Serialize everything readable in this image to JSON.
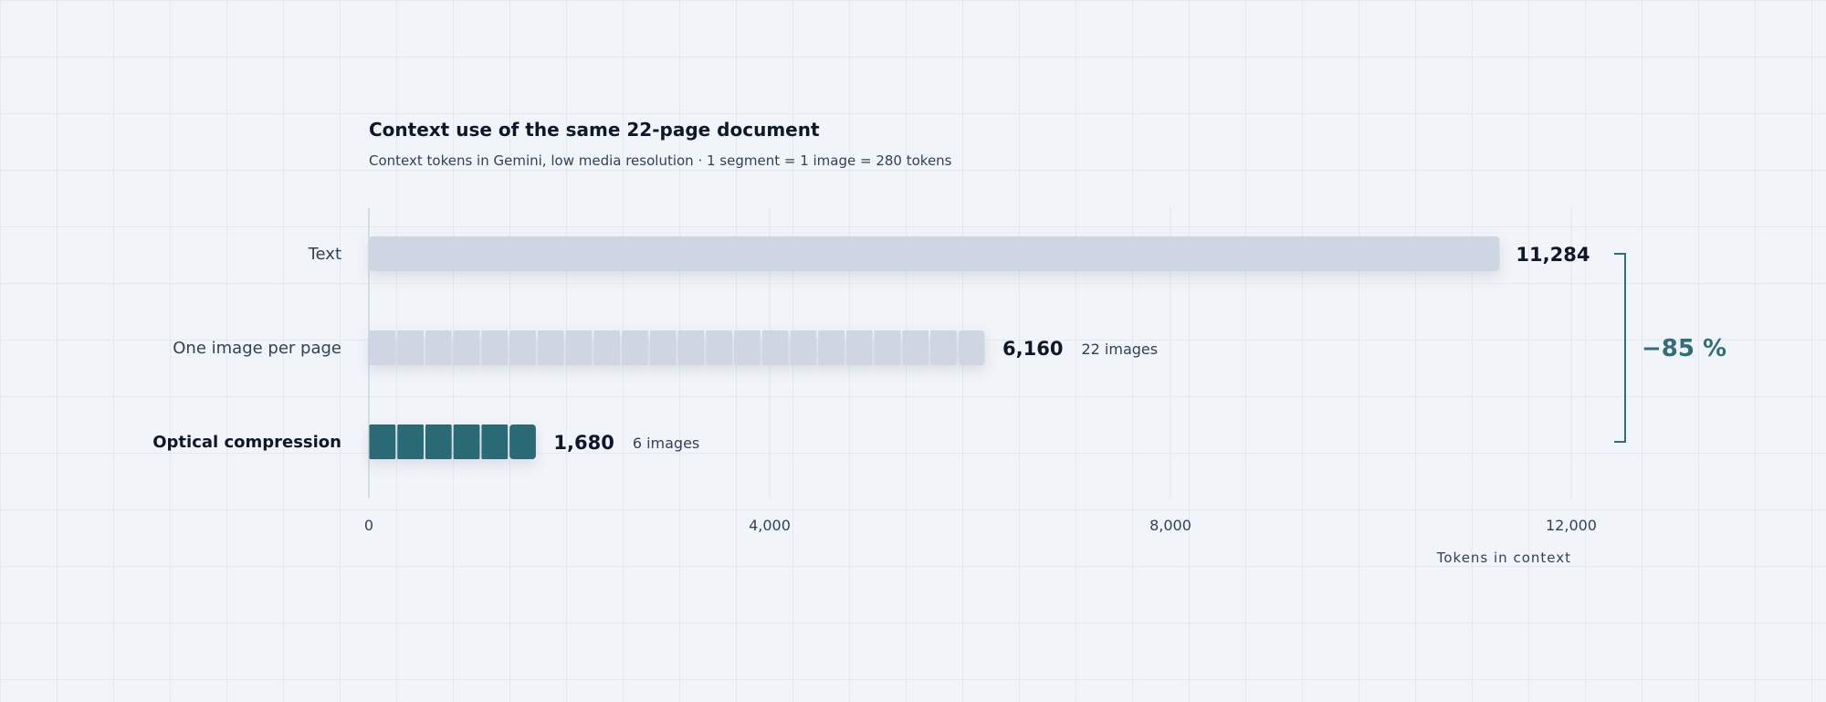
{
  "chart_data": {
    "type": "bar",
    "orientation": "horizontal",
    "title": "Context use of the same 22-page document",
    "subtitle": "Context tokens in Gemini, low media resolution · 1 segment = 1 image = 280 tokens",
    "xlabel": "Tokens in context",
    "ylabel": "",
    "xlim": [
      0,
      12000
    ],
    "ticks": [
      {
        "value": 0,
        "label": "0"
      },
      {
        "value": 4000,
        "label": "4,000"
      },
      {
        "value": 8000,
        "label": "8,000"
      },
      {
        "value": 12000,
        "label": "12,000"
      }
    ],
    "grid": true,
    "segment_tokens": 280,
    "categories": [
      "Text",
      "One image per page",
      "Optical compression"
    ],
    "values": [
      11284,
      6160,
      1680
    ],
    "value_labels": [
      "11,284",
      "6,160",
      "1,680"
    ],
    "segments": [
      0,
      22,
      6
    ],
    "notes": [
      "",
      "22 images",
      "6 images"
    ],
    "emphasized": [
      false,
      false,
      true
    ],
    "bar_colors": [
      "#cdd6e2",
      "#cdd6e2",
      "#2b6b74"
    ],
    "annotation": {
      "label": "−85 %",
      "from_category": "Text",
      "to_category": "Optical compression",
      "color": "#2f6f78"
    }
  }
}
